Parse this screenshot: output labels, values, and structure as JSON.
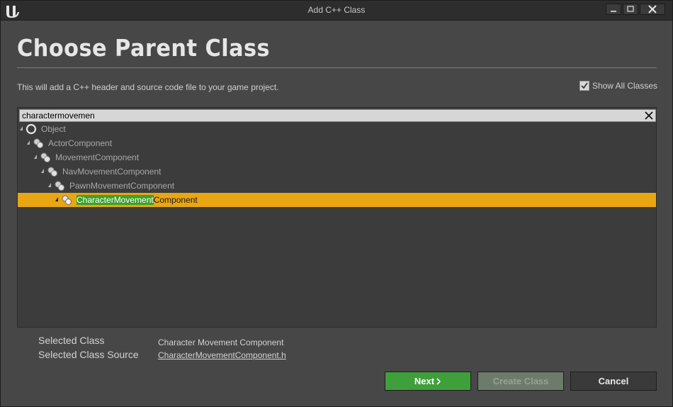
{
  "window": {
    "title": "Add C++ Class",
    "controls": [
      "minimize-icon",
      "maximize-icon",
      "close-icon"
    ]
  },
  "page": {
    "title": "Choose Parent Class",
    "description": "This will add a C++ header and source code file to your game project.",
    "show_all_classes": {
      "label": "Show All Classes",
      "checked": true
    }
  },
  "search": {
    "value": "charactermovemen",
    "placeholder": ""
  },
  "tree": [
    {
      "label": "Object",
      "icon": "object-circle-icon",
      "depth": 0
    },
    {
      "label": "ActorComponent",
      "icon": "component-gears-icon",
      "depth": 1
    },
    {
      "label": "MovementComponent",
      "icon": "component-gears-icon",
      "depth": 2
    },
    {
      "label": "NavMovementComponent",
      "icon": "component-gears-icon",
      "depth": 3
    },
    {
      "label": "PawnMovementComponent",
      "icon": "component-gears-icon",
      "depth": 4
    },
    {
      "label_highlight": "CharacterMovement",
      "label_rest": "Component",
      "icon": "component-gears-icon",
      "depth": 5,
      "selected": true
    }
  ],
  "selection": {
    "class_label": "Selected Class",
    "class_value": "Character Movement Component",
    "source_label": "Selected Class Source",
    "source_value": "CharacterMovementComponent.h"
  },
  "buttons": {
    "next": "Next",
    "create": "Create Class",
    "cancel": "Cancel"
  },
  "colors": {
    "selected_row": "#e8a613",
    "search_highlight": "#3aa12a",
    "next_button": "#3f9f3a",
    "create_button_disabled": "#6d7c6a"
  }
}
